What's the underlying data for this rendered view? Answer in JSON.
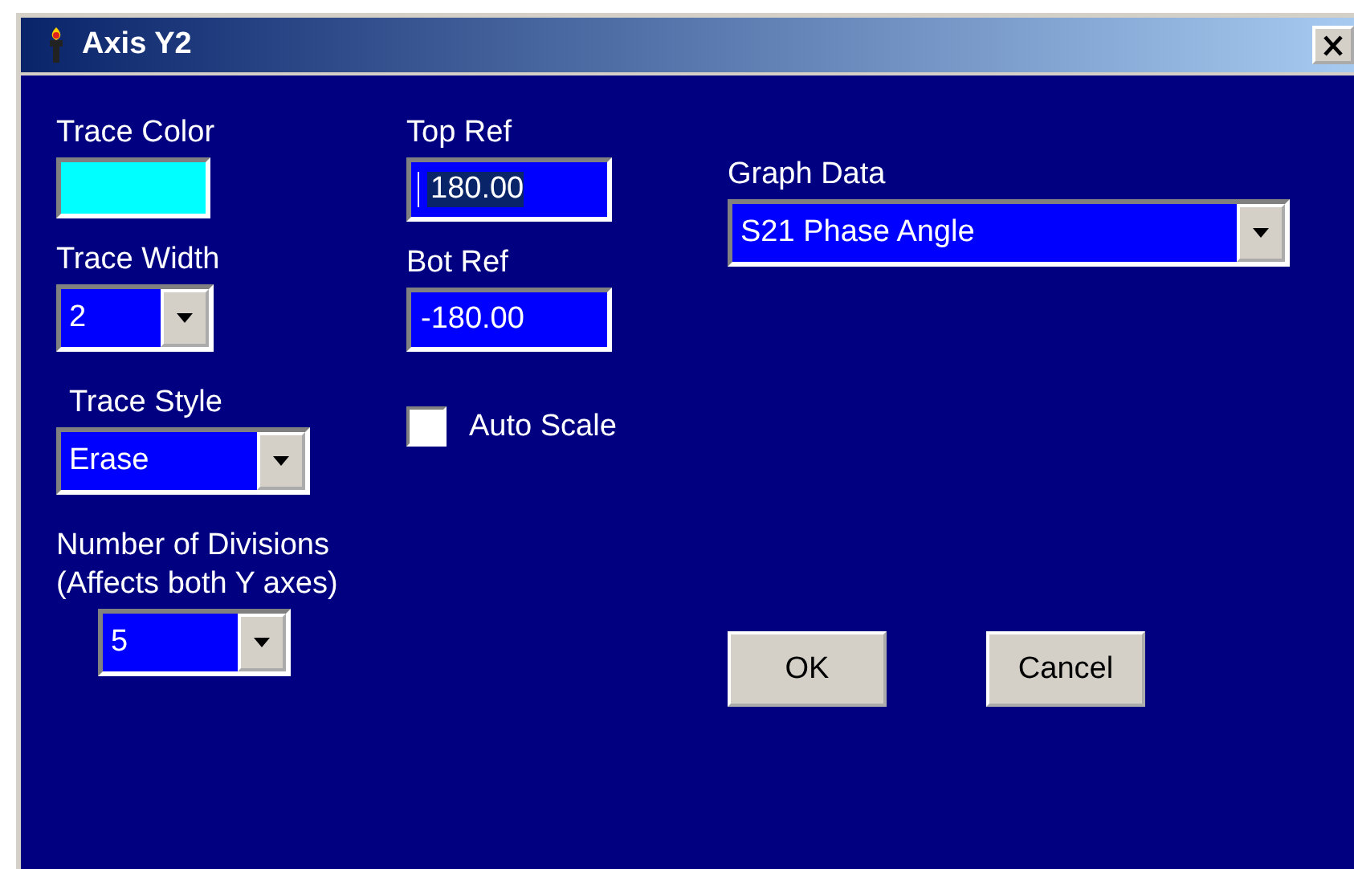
{
  "window": {
    "title": "Axis Y2"
  },
  "trace_color": {
    "label": "Trace Color",
    "color": "#00ffff"
  },
  "trace_width": {
    "label": "Trace Width",
    "value": "2"
  },
  "trace_style": {
    "label": "Trace Style",
    "value": "Erase"
  },
  "divisions": {
    "label": "Number of Divisions",
    "note": "(Affects both Y axes)",
    "value": "5"
  },
  "top_ref": {
    "label": "Top Ref",
    "value": "180.00",
    "focused": true
  },
  "bot_ref": {
    "label": "Bot Ref",
    "value": "-180.00",
    "focused": false
  },
  "auto_scale": {
    "label": "Auto Scale",
    "checked": false
  },
  "graph_data": {
    "label": "Graph Data",
    "value": "S21 Phase Angle"
  },
  "buttons": [
    "OK",
    "Cancel"
  ]
}
